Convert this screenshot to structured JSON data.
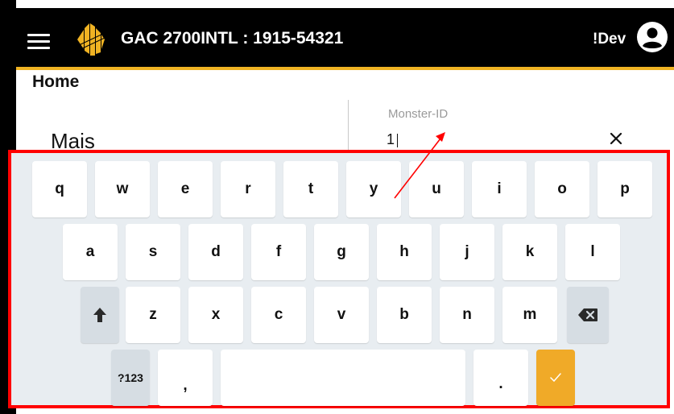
{
  "header": {
    "title": "GAC 2700INTL : 1915-54321",
    "user_label": "!Dev",
    "menu_icon": "hamburger-menu-icon",
    "logo": "brand-logo",
    "avatar_icon": "account-circle-icon",
    "accent_color": "#f0b323"
  },
  "page": {
    "title": "Home",
    "section_label": "Mais"
  },
  "sample_field": {
    "label": "Monster-ID",
    "value": "1",
    "clear_icon": "close-icon"
  },
  "keyboard": {
    "row1": [
      "q",
      "w",
      "e",
      "r",
      "t",
      "y",
      "u",
      "i",
      "o",
      "p"
    ],
    "row2": [
      "a",
      "s",
      "d",
      "f",
      "g",
      "h",
      "j",
      "k",
      "l"
    ],
    "row3": [
      "z",
      "x",
      "c",
      "v",
      "b",
      "n",
      "m"
    ],
    "shift_icon": "shift-arrow-icon",
    "backspace_icon": "backspace-icon",
    "symbols_label": "?123",
    "comma_label": ",",
    "period_label": ".",
    "enter_icon": "checkmark-icon",
    "enter_color": "#f0aa28",
    "highlight_color": "#ff0000"
  }
}
